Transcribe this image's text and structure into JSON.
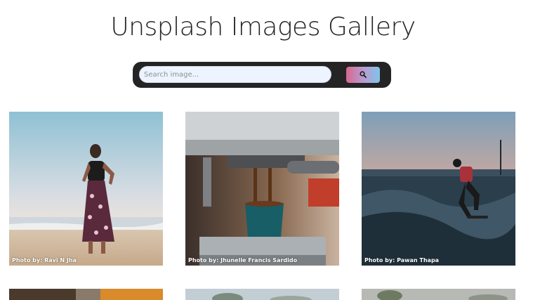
{
  "header": {
    "title": "Unsplash Images Gallery"
  },
  "search": {
    "placeholder": "Search image...",
    "value": "",
    "button_icon": "search-icon"
  },
  "colors": {
    "search_bar_bg": "#242424",
    "button_gradient_start": "#d6688f",
    "button_gradient_end": "#7fc4ea"
  },
  "gallery": {
    "cards": [
      {
        "credit": "Photo by: Ravi N Jha"
      },
      {
        "credit": "Photo by: Jhunelle Francis Sardido"
      },
      {
        "credit": "Photo by: Pawan Thapa"
      }
    ]
  }
}
